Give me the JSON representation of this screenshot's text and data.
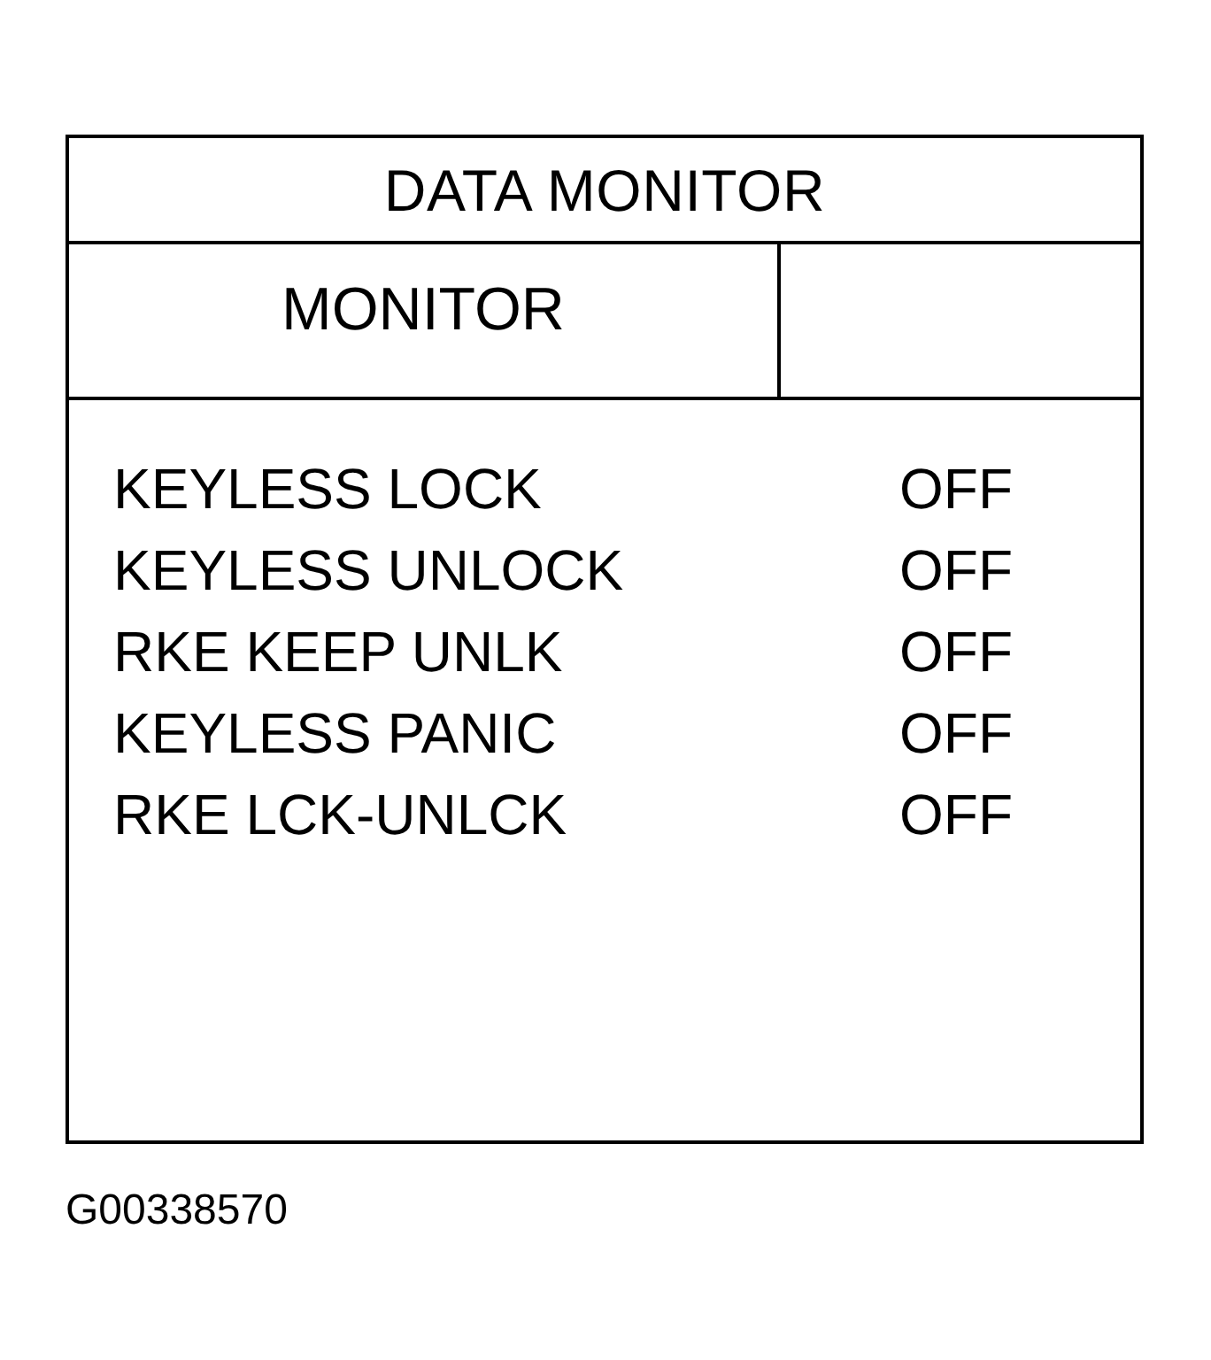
{
  "panel": {
    "title": "DATA MONITOR",
    "header": {
      "column_1": "MONITOR"
    }
  },
  "items": [
    {
      "label": "KEYLESS LOCK",
      "value": "OFF"
    },
    {
      "label": "KEYLESS UNLOCK",
      "value": "OFF"
    },
    {
      "label": "RKE KEEP UNLK",
      "value": "OFF"
    },
    {
      "label": "KEYLESS PANIC",
      "value": "OFF"
    },
    {
      "label": "RKE LCK-UNLCK",
      "value": "OFF"
    }
  ],
  "figure_id": "G00338570"
}
